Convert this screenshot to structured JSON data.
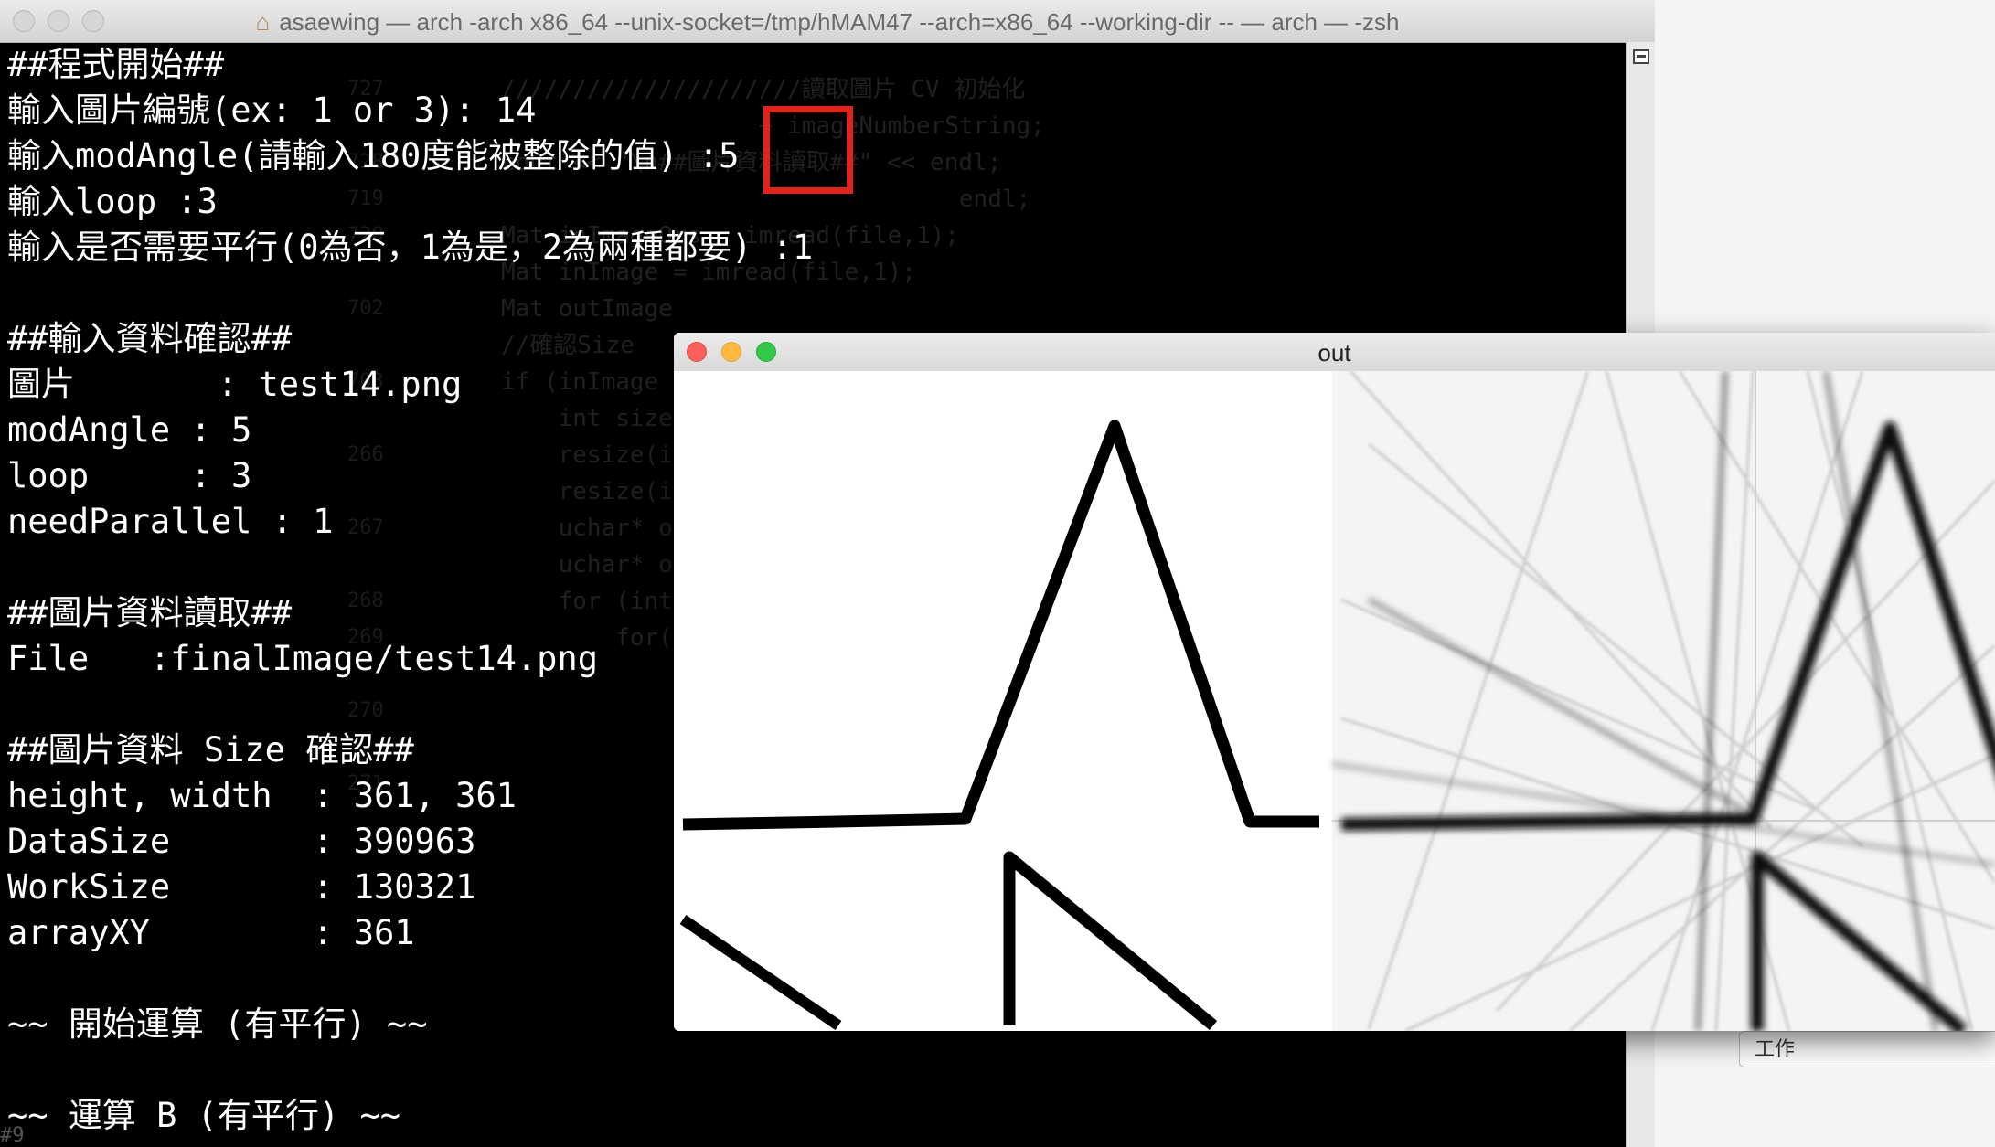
{
  "terminal": {
    "title": "asaewing — arch -arch x86_64  --unix-socket=/tmp/hMAM47 --arch=x86_64 --working-dir  -- — arch — -zsh",
    "lines": [
      "##程式開始##",
      "輸入圖片編號(ex: 1 or 3): 14",
      "輸入modAngle(請輸入180度能被整除的值) :5",
      "輸入loop :3",
      "輸入是否需要平行(0為否，1為是，2為兩種都要) :1",
      "",
      "##輸入資料確認##",
      "圖片       : test14.png",
      "modAngle : 5",
      "loop     : 3",
      "needParallel : 1",
      "",
      "##圖片資料讀取##",
      "File   :finalImage/test14.png",
      "",
      "##圖片資料 Size 確認##",
      "height, width  : 361, 361",
      "DataSize       : 390963",
      "WorkSize       : 130321",
      "arrayXY        : 361",
      "",
      "~~ 開始運算 (有平行) ~~",
      "",
      "~~ 運算 B (有平行) ~~"
    ],
    "background_code": [
      "/////////////////////讀取圖片 CV 初始化",
      "                  + imageNumberString;",
      "cout << \"\\n##圖片資料讀取##\" << endl;",
      "                                endl;",
      "Mat inImageOrs = imread(file,1);",
      "Mat inImage = imread(file,1);",
      "Mat outImage",
      "",
      "//確認Size",
      "if (inImage",
      "    int size",
      "    resize(i",
      "    resize(i",
      "",
      "    uchar* o",
      "    uchar* o",
      "",
      "    for (int",
      "        for("
    ],
    "line_numbers": [
      "727",
      "",
      "728",
      "719",
      "720",
      "",
      "702",
      "",
      "703",
      "",
      "266",
      "",
      "267",
      "",
      "268",
      "269",
      "",
      "270",
      "",
      "271"
    ],
    "bottom_tab": "#9"
  },
  "out_window": {
    "title": "out"
  },
  "side_panel": {
    "tab_label": "工作"
  },
  "colors": {
    "highlight": "#e2231a",
    "close": "#fc605b",
    "minimize": "#fdbc40",
    "zoom": "#34c84a"
  }
}
